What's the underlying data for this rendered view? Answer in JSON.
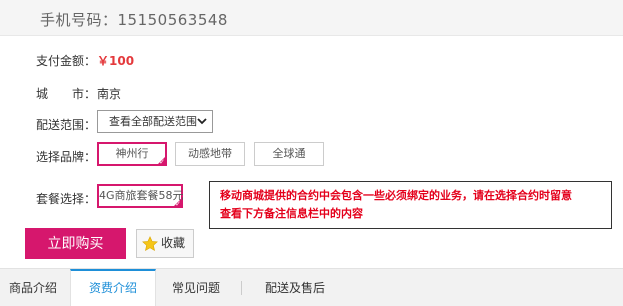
{
  "header": {
    "phone_label": "手机号码：15150563548"
  },
  "form": {
    "pay_label": "支付金额：",
    "pay_value": "￥100",
    "city_label": "城　　市：",
    "city_value": "南京",
    "range_label": "配送范围：",
    "range_select": "查看全部配送范围",
    "brand_label": "选择品牌：",
    "brands": [
      "神州行",
      "动感地带",
      "全球通"
    ],
    "selected_brand": "神州行",
    "package_label": "套餐选择：",
    "package_option": "4G商旅套餐58元"
  },
  "notice": {
    "line1": "移动商城提供的合约中会包含一些必须绑定的业务，请在选择合约时留意",
    "line2": "查看下方备注信息栏中的内容"
  },
  "actions": {
    "buy_label": "立即购买",
    "fav_label": "收藏"
  },
  "tabs": [
    {
      "label": "商品介绍",
      "active": false
    },
    {
      "label": "资费介绍",
      "active": true
    },
    {
      "label": "常见问题",
      "active": false
    },
    {
      "label": "配送及售后",
      "active": false
    }
  ],
  "colors": {
    "accent": "#d6176d",
    "price": "#e4393c",
    "notice_text": "#e4001b",
    "tab_active": "#1e8fd8"
  },
  "icons": {
    "favorite": "star-icon",
    "dropdown": "chevron-down-icon",
    "selected_mark": "check-icon"
  }
}
